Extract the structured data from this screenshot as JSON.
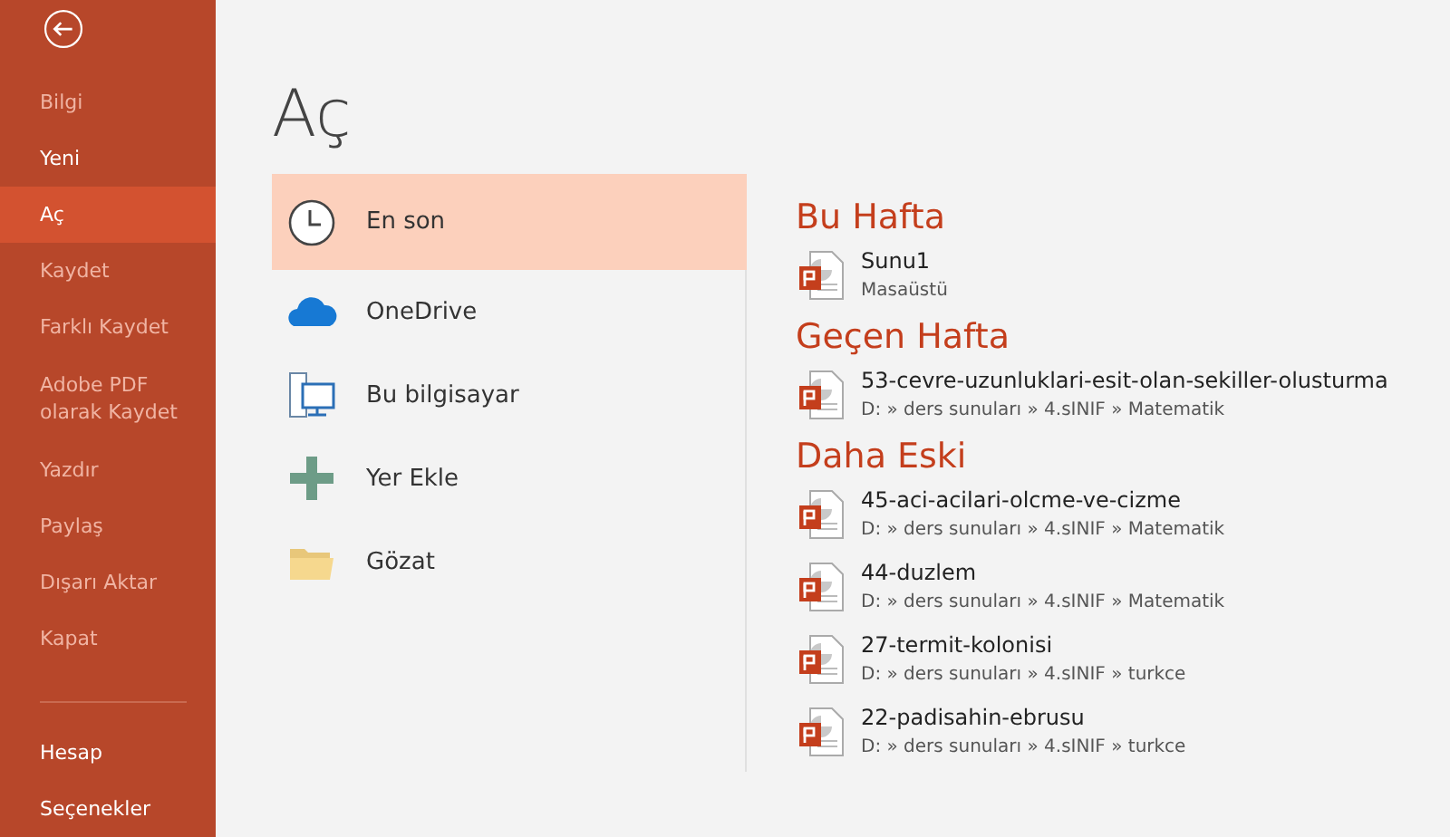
{
  "sidebar": {
    "items": [
      {
        "label": "Bilgi",
        "disabled": true,
        "selected": false
      },
      {
        "label": "Yeni",
        "disabled": false,
        "selected": false
      },
      {
        "label": "Aç",
        "disabled": false,
        "selected": true
      },
      {
        "label": "Kaydet",
        "disabled": true,
        "selected": false
      },
      {
        "label": "Farklı Kaydet",
        "disabled": true,
        "selected": false
      },
      {
        "label": "Adobe PDF olarak Kaydet",
        "disabled": true,
        "selected": false
      },
      {
        "label": "Yazdır",
        "disabled": true,
        "selected": false
      },
      {
        "label": "Paylaş",
        "disabled": true,
        "selected": false
      },
      {
        "label": "Dışarı Aktar",
        "disabled": true,
        "selected": false
      },
      {
        "label": "Kapat",
        "disabled": true,
        "selected": false
      }
    ],
    "bottom_items": [
      {
        "label": "Hesap"
      },
      {
        "label": "Seçenekler"
      }
    ]
  },
  "title": "Aç",
  "places": [
    {
      "kind": "recent",
      "label": "En son",
      "selected": true
    },
    {
      "kind": "onedrive",
      "label": "OneDrive",
      "selected": false
    },
    {
      "kind": "computer",
      "label": "Bu bilgisayar",
      "selected": false
    },
    {
      "kind": "add",
      "label": "Yer Ekle",
      "selected": false
    },
    {
      "kind": "browse",
      "label": "Gözat",
      "selected": false
    }
  ],
  "groups": [
    {
      "heading": "Bu Hafta",
      "files": [
        {
          "name": "Sunu1",
          "path": "Masaüstü"
        }
      ]
    },
    {
      "heading": "Geçen Hafta",
      "files": [
        {
          "name": "53-cevre-uzunluklari-esit-olan-sekiller-olusturma",
          "path": "D: » ders sunuları » 4.sINIF » Matematik"
        }
      ]
    },
    {
      "heading": "Daha Eski",
      "files": [
        {
          "name": "45-aci-acilari-olcme-ve-cizme",
          "path": "D: » ders sunuları » 4.sINIF » Matematik"
        },
        {
          "name": "44-duzlem",
          "path": "D: » ders sunuları » 4.sINIF » Matematik"
        },
        {
          "name": "27-termit-kolonisi",
          "path": "D: » ders sunuları » 4.sINIF » turkce"
        },
        {
          "name": "22-padisahin-ebrusu",
          "path": "D: » ders sunuları » 4.sINIF » turkce"
        }
      ]
    }
  ]
}
